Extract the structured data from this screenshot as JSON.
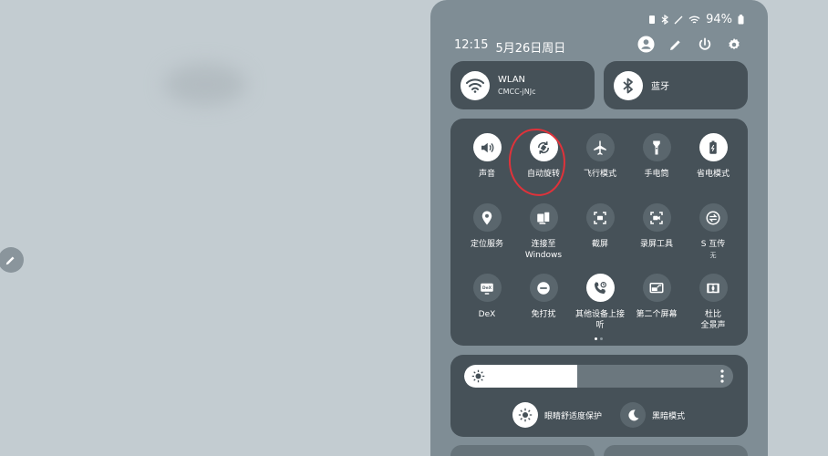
{
  "status": {
    "battery_pct": "94%"
  },
  "header": {
    "time": "12:15",
    "date": "5月26日周日"
  },
  "wlan": {
    "label": "WLAN",
    "network": "CMCC-jNJc"
  },
  "bluetooth": {
    "label": "蓝牙"
  },
  "tiles": [
    {
      "label": "声音",
      "sub": "",
      "active": true,
      "icon": "volume-icon"
    },
    {
      "label": "自动旋转",
      "sub": "",
      "active": true,
      "icon": "auto-rotate-icon"
    },
    {
      "label": "飞行模式",
      "sub": "",
      "active": false,
      "icon": "airplane-icon"
    },
    {
      "label": "手电筒",
      "sub": "",
      "active": false,
      "icon": "flashlight-icon"
    },
    {
      "label": "省电模式",
      "sub": "",
      "active": true,
      "icon": "battery-saver-icon"
    },
    {
      "label": "定位服务",
      "sub": "",
      "active": false,
      "icon": "location-icon"
    },
    {
      "label": "连接至",
      "sub": "Windows",
      "active": false,
      "icon": "link-to-windows-icon"
    },
    {
      "label": "截屏",
      "sub": "",
      "active": false,
      "icon": "screenshot-icon"
    },
    {
      "label": "录屏工具",
      "sub": "",
      "active": false,
      "icon": "screen-record-icon"
    },
    {
      "label": "S 互传",
      "sub": "无",
      "active": false,
      "icon": "quick-share-icon"
    },
    {
      "label": "DeX",
      "sub": "",
      "active": false,
      "icon": "dex-icon"
    },
    {
      "label": "免打扰",
      "sub": "",
      "active": false,
      "icon": "do-not-disturb-icon"
    },
    {
      "label": "其他设备上接听",
      "sub": "",
      "active": true,
      "icon": "call-other-devices-icon"
    },
    {
      "label": "第二个屏幕",
      "sub": "",
      "active": false,
      "icon": "second-screen-icon"
    },
    {
      "label": "杜比",
      "sub": "全景声",
      "active": false,
      "icon": "dolby-icon"
    }
  ],
  "brightness": {
    "level": 0.42
  },
  "eye_comfort": {
    "label": "眼睛舒适度保护"
  },
  "dark_mode": {
    "label": "黑暗模式"
  }
}
